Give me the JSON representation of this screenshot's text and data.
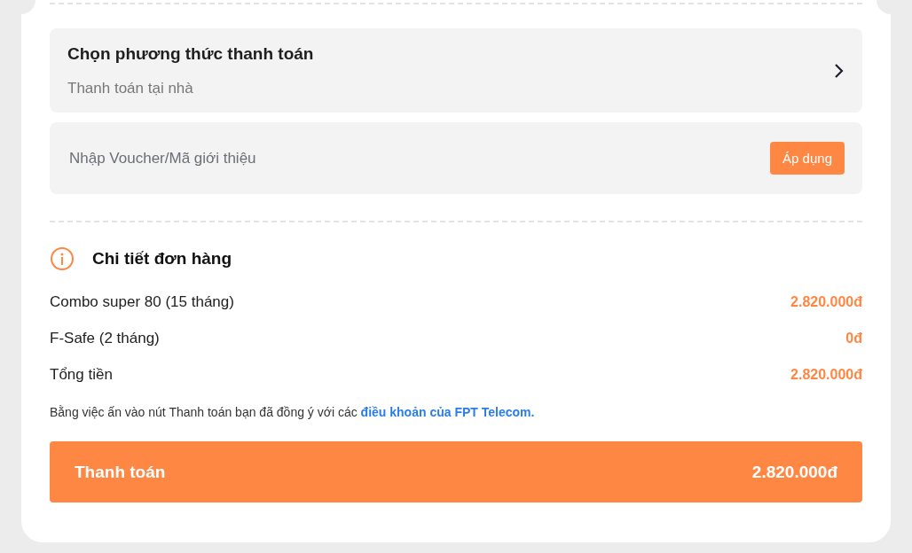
{
  "payment_method": {
    "title": "Chọn phương thức thanh toán",
    "value": "Thanh toán tại nhà"
  },
  "voucher": {
    "placeholder": "Nhập Voucher/Mã giới thiệu",
    "button": "Áp dụng"
  },
  "order_details": {
    "title": "Chi tiết đơn hàng",
    "rows": [
      {
        "label": "Combo super 80 (15 tháng)",
        "amount": "2.820.000đ"
      },
      {
        "label": "F-Safe (2 tháng)",
        "amount": "0đ"
      },
      {
        "label": "Tổng tiền",
        "amount": "2.820.000đ"
      }
    ]
  },
  "terms": {
    "text": "Bằng việc ấn vào nút Thanh toán bạn đã đồng ý với các",
    "link": "điều khoản của FPT Telecom."
  },
  "pay_button": {
    "label": "Thanh toán",
    "amount": "2.820.000đ"
  }
}
